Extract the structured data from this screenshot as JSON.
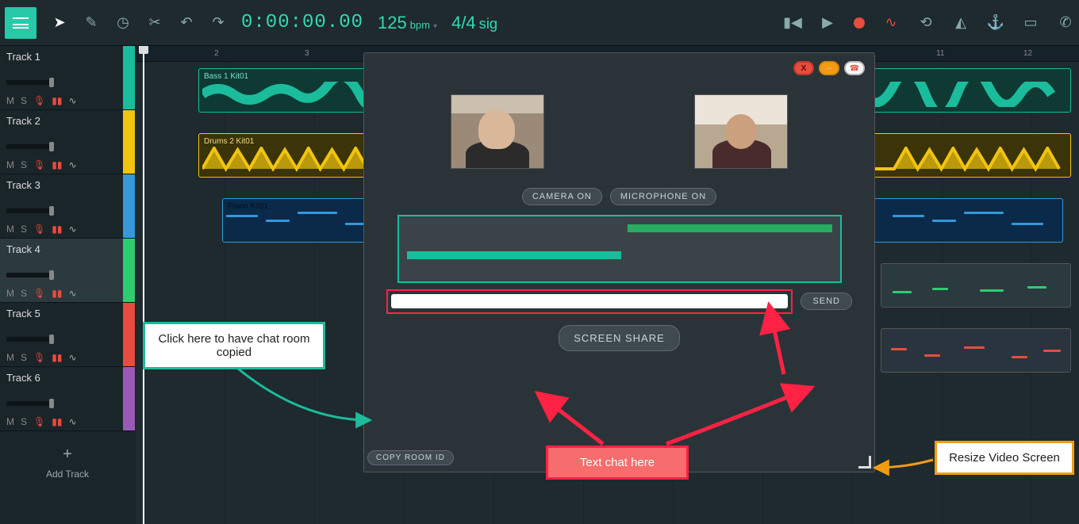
{
  "toolbar": {
    "time": "0:00:00.00",
    "bpm_value": "125",
    "bpm_label": "bpm",
    "sig_value": "4/4",
    "sig_label": "sig"
  },
  "tracks": [
    {
      "name": "Track 1",
      "color": "#1abc9c",
      "clip_label": "Bass 1 Kit01"
    },
    {
      "name": "Track 2",
      "color": "#f1c40f",
      "clip_label": "Drums 2 Kit01"
    },
    {
      "name": "Track 3",
      "color": "#3498db",
      "clip_label": "Piano Kit01"
    },
    {
      "name": "Track 4",
      "color": "#2ecc71",
      "clip_label": ""
    },
    {
      "name": "Track 5",
      "color": "#e74c3c",
      "clip_label": ""
    },
    {
      "name": "Track 6",
      "color": "#9b59b6",
      "clip_label": ""
    }
  ],
  "add_track_label": "Add Track",
  "track_buttons": {
    "mute": "M",
    "solo": "S"
  },
  "ruler_marks": [
    "2",
    "3",
    "11",
    "12"
  ],
  "video": {
    "camera_btn": "CAMERA ON",
    "mic_btn": "MICROPHONE ON",
    "send_btn": "SEND",
    "share_btn": "SCREEN SHARE",
    "copy_btn": "COPY ROOM ID",
    "close_label": "X",
    "min_label": "–"
  },
  "callouts": {
    "copy": "Click here to have chat room copied",
    "text_chat": "Text chat here",
    "resize": "Resize Video Screen"
  }
}
